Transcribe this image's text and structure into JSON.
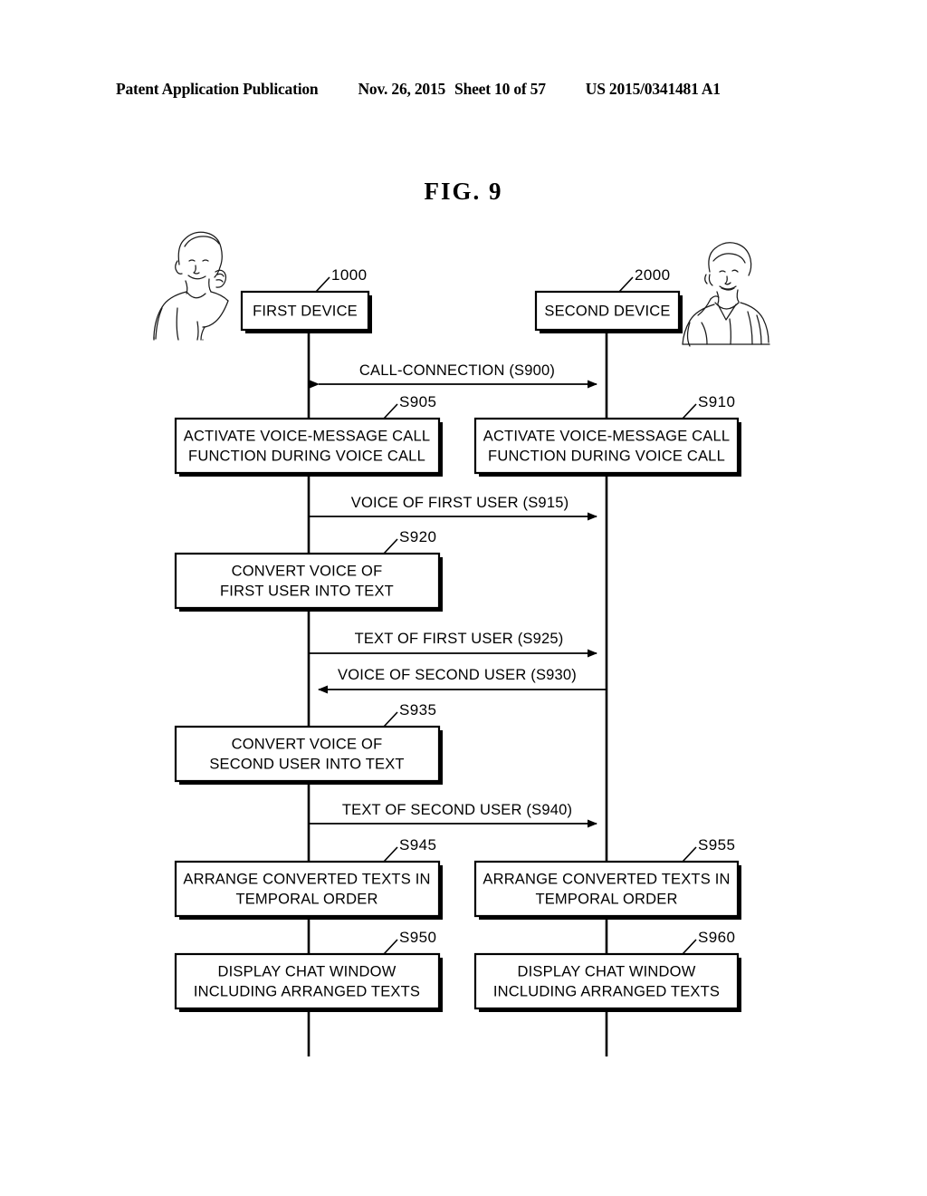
{
  "header": {
    "publication": "Patent Application Publication",
    "date": "Nov. 26, 2015",
    "sheet": "Sheet 10 of 57",
    "number": "US 2015/0341481 A1"
  },
  "figure": {
    "title": "FIG.  9"
  },
  "lifelines": [
    {
      "id": "first-device",
      "label": "FIRST DEVICE",
      "ref": "1000"
    },
    {
      "id": "second-device",
      "label": "SECOND DEVICE",
      "ref": "2000"
    }
  ],
  "actors": [
    {
      "id": "first-user-illustration",
      "name": "person-on-phone-left"
    },
    {
      "id": "second-user-illustration",
      "name": "person-on-phone-right"
    }
  ],
  "messages": [
    {
      "id": "s900",
      "label": "CALL-CONNECTION (S900)",
      "direction": "both"
    },
    {
      "id": "s915",
      "label": "VOICE OF FIRST USER (S915)",
      "direction": "right"
    },
    {
      "id": "s925",
      "label": "TEXT OF FIRST USER (S925)",
      "direction": "right"
    },
    {
      "id": "s930",
      "label": "VOICE OF SECOND USER (S930)",
      "direction": "left"
    },
    {
      "id": "s940",
      "label": "TEXT OF SECOND USER (S940)",
      "direction": "right"
    }
  ],
  "steps": [
    {
      "id": "s905",
      "ref": "S905",
      "lane": "left",
      "lines": [
        "ACTIVATE VOICE-MESSAGE CALL",
        "FUNCTION DURING VOICE CALL"
      ]
    },
    {
      "id": "s910",
      "ref": "S910",
      "lane": "right",
      "lines": [
        "ACTIVATE VOICE-MESSAGE CALL",
        "FUNCTION DURING VOICE CALL"
      ]
    },
    {
      "id": "s920",
      "ref": "S920",
      "lane": "left",
      "lines": [
        "CONVERT VOICE OF",
        "FIRST USER INTO TEXT"
      ]
    },
    {
      "id": "s935",
      "ref": "S935",
      "lane": "left",
      "lines": [
        "CONVERT VOICE OF",
        "SECOND USER INTO TEXT"
      ]
    },
    {
      "id": "s945",
      "ref": "S945",
      "lane": "left",
      "lines": [
        "ARRANGE CONVERTED TEXTS IN",
        "TEMPORAL ORDER"
      ]
    },
    {
      "id": "s955",
      "ref": "S955",
      "lane": "right",
      "lines": [
        "ARRANGE CONVERTED TEXTS IN",
        "TEMPORAL ORDER"
      ]
    },
    {
      "id": "s950",
      "ref": "S950",
      "lane": "left",
      "lines": [
        "DISPLAY CHAT WINDOW",
        "INCLUDING ARRANGED TEXTS"
      ]
    },
    {
      "id": "s960",
      "ref": "S960",
      "lane": "right",
      "lines": [
        "DISPLAY CHAT WINDOW",
        "INCLUDING ARRANGED TEXTS"
      ]
    }
  ],
  "colors": {
    "ink": "#000000",
    "paper": "#ffffff"
  }
}
